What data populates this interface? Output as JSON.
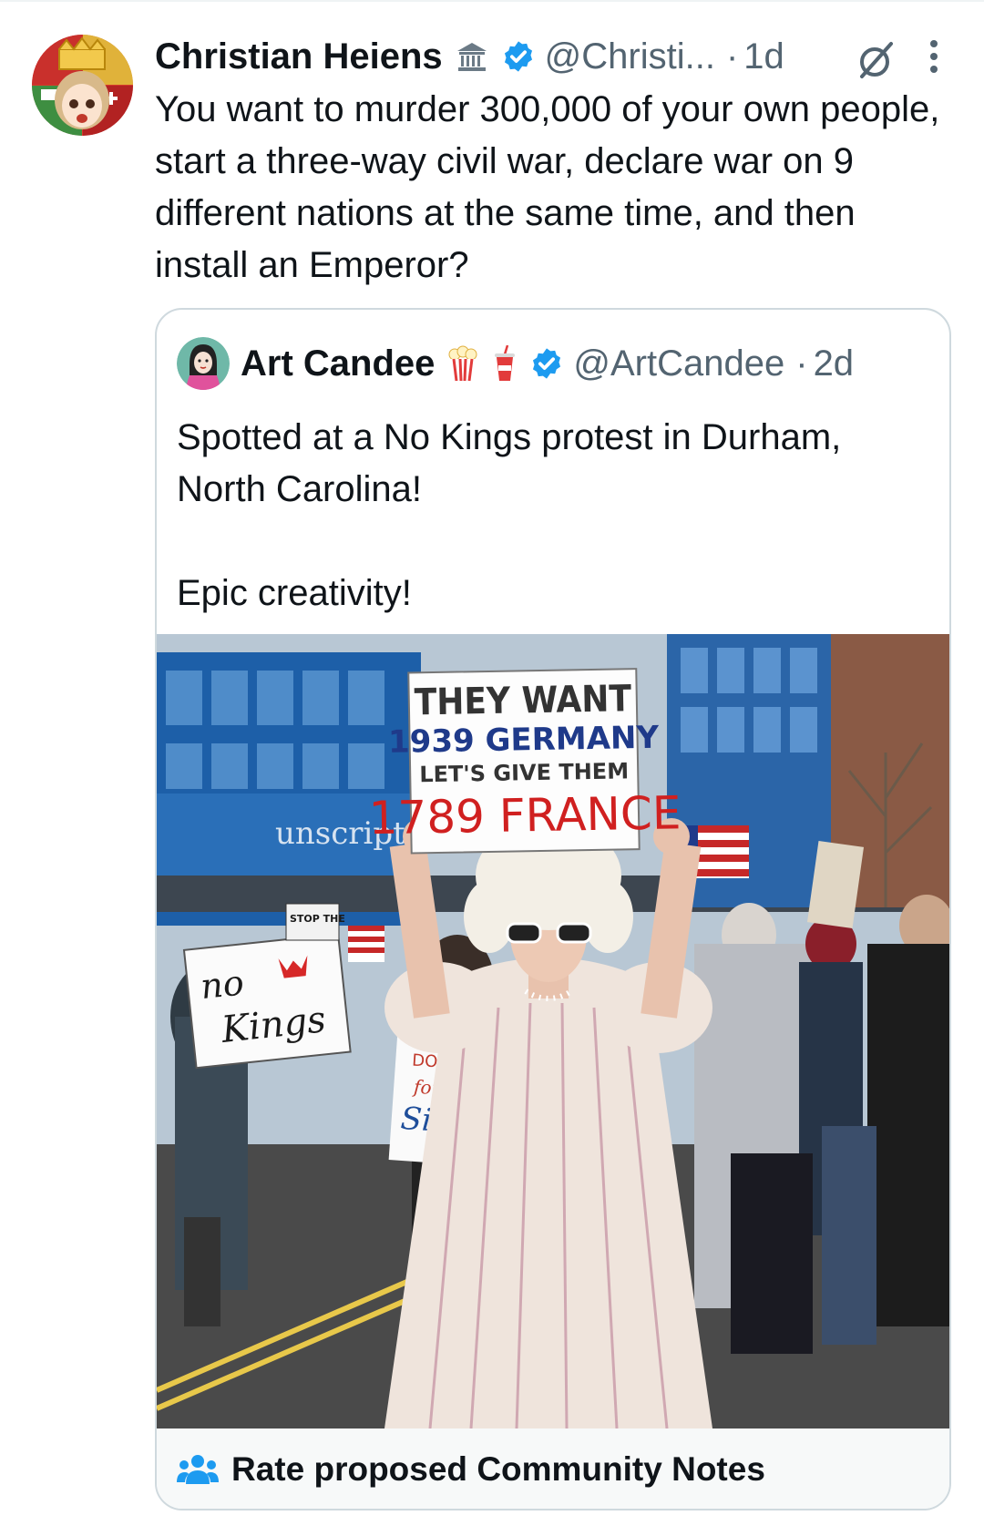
{
  "tweet": {
    "author_name": "Christian Heiens",
    "handle": "@Christi...",
    "separator": "·",
    "age": "1d",
    "text": "You want to murder 300,000 of your own people, start a three-way civil war, declare war on 9 different nations at the same time, and then install an Emperor?",
    "icons": [
      "classical-building-icon",
      "verified-badge-icon",
      "grok-icon",
      "more-options-icon"
    ]
  },
  "quote": {
    "author_name": "Art Candee",
    "handle": "@ArtCandee",
    "separator": "·",
    "age": "2d",
    "text_lines": [
      "Spotted at a No Kings protest in Durham, North Carolina!",
      "Epic creativity!"
    ],
    "icons": [
      "popcorn-icon",
      "soda-cup-icon",
      "verified-badge-icon"
    ]
  },
  "photo": {
    "main_sign": {
      "line1": "THEY WANT",
      "line2": "1939 GERMANY",
      "line3": "LET'S GIVE THEM",
      "line4": "1789 FRANCE"
    },
    "left_sign": {
      "line1": "no",
      "line2": "Kings"
    },
    "small_sign": "STOP THE",
    "storefront": "unscripted",
    "middle_sign": {
      "line1": "DOES",
      "line2": "forgiv",
      "line3": "Silen"
    }
  },
  "community_notes": {
    "label": "Rate proposed Community Notes",
    "icon": "people-icon"
  },
  "colors": {
    "verified": "#1d9bf0",
    "secondary_text": "#536471",
    "border": "#cfd9de"
  }
}
